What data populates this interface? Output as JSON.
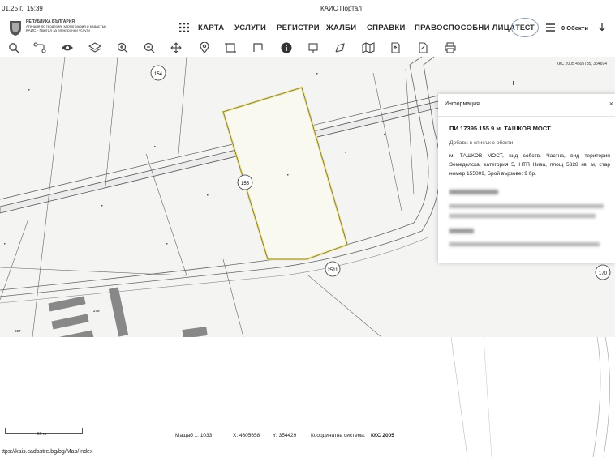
{
  "print": {
    "date": "01.25 г., 15:39",
    "title": "КАИС Портал"
  },
  "logo": {
    "line1": "РЕПУБЛИКА БЪЛГАРИЯ",
    "line2": "Агенция по геодезия, картография и кадастър",
    "line3": "КАИС - Портал за електронни услуги"
  },
  "nav": {
    "items": [
      "КАРТА",
      "УСЛУГИ",
      "РЕГИСТРИ",
      "ЖАЛБИ",
      "СПРАВКИ",
      "ПРАВОСПОСОБНИ ЛИЦА"
    ],
    "test": "ТЕСТ",
    "objects": "0 Обекти"
  },
  "map": {
    "top_coords": "ККС 2005 4605735, 354694",
    "parcel_labels": [
      "154",
      "155",
      "2511",
      "170",
      "279",
      "267"
    ]
  },
  "info": {
    "header": "Информация",
    "close": "×",
    "title": "ПИ 17395.155.9 м. ТАШКОВ МОСТ",
    "add": "Добави в списък с обекти",
    "description": "м. ТАШКОВ МОСТ, вид собств. Частна, вид територия Земеделска, категория 5, НТП Нива, площ 5328 кв. м, стар номер 155009, Брой вързове: 9 бр."
  },
  "footer": {
    "scale_label": "50 m",
    "scale_text": "Мащаб 1:  1033",
    "x_text": "X:  4605658",
    "y_text": "Y:  354429",
    "crs_label": "Координатна система:",
    "crs_value": "ККС 2005",
    "url": "ttps://kais.cadastre.bg/bg/Map/Index"
  }
}
